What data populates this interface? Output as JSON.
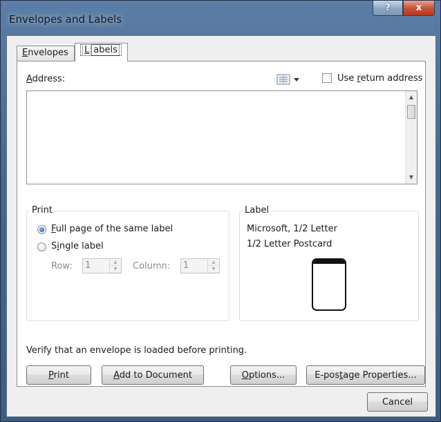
{
  "window": {
    "title": "Envelopes and Labels",
    "help_glyph": "?",
    "close_glyph": "x"
  },
  "tabs": {
    "envelopes": "Envelopes",
    "labels": "Labels"
  },
  "address": {
    "label": "Address:",
    "value": "",
    "use_return_address_label": "Use return address",
    "use_return_address_checked": false,
    "icon": "address-book-icon"
  },
  "print_group": {
    "legend": "Print",
    "full_page_label": "Full page of the same label",
    "full_page_selected": true,
    "single_label": "Single label",
    "single_selected": false,
    "row_label": "Row:",
    "row_value": "1",
    "column_label": "Column:",
    "column_value": "1"
  },
  "label_group": {
    "legend": "Label",
    "vendor": "Microsoft, 1/2 Letter",
    "product": "1/2 Letter Postcard"
  },
  "verify_text": "Verify that an envelope is loaded before printing.",
  "buttons": {
    "print": "Print",
    "add_to_document": "Add to Document",
    "options": "Options...",
    "epostage": "E-postage Properties...",
    "cancel": "Cancel"
  },
  "scroll": {
    "up": "▲",
    "down": "▼"
  },
  "spin": {
    "up": "▲",
    "down": "▼"
  },
  "colors": {
    "title_bar": "#47688f",
    "close_button": "#c7553b",
    "dialog_bg": "#efefef",
    "radio_selected": "#1d5aa8"
  }
}
